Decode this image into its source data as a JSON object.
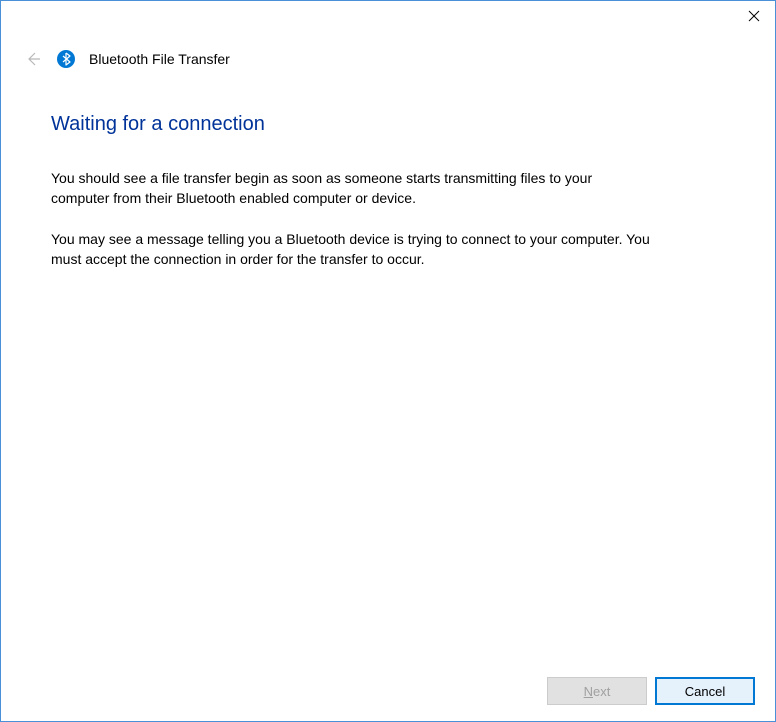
{
  "wizard": {
    "title": "Bluetooth File Transfer"
  },
  "content": {
    "heading": "Waiting for a connection",
    "paragraph1": "You should see a file transfer begin as soon as someone starts transmitting files to your computer from their Bluetooth enabled computer or device.",
    "paragraph2": "You may see a message telling you a Bluetooth device is trying to connect to your computer. You must accept the connection in order for the transfer to occur."
  },
  "buttons": {
    "next_prefix": "N",
    "next_rest": "ext",
    "cancel": "Cancel"
  }
}
